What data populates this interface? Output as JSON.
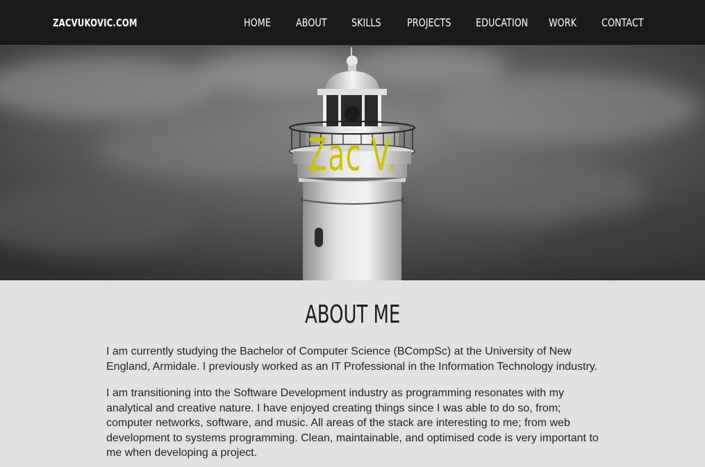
{
  "nav": {
    "brand": "ZACVUKOVIC.COM",
    "links": [
      "HOME",
      "ABOUT",
      "SKILLS",
      "PROJECTS",
      "EDUCATION",
      "WORK",
      "CONTACT"
    ]
  },
  "hero": {
    "title": "Zac V."
  },
  "about": {
    "heading": "ABOUT ME",
    "paragraphs": [
      "I am currently studying the Bachelor of Computer Science (BCompSc) at the University of New England, Armidale. I previously worked as an IT Professional in the Information Technology industry.",
      "I am transitioning into the Software Development industry as programming resonates with my analytical and creative nature. I have enjoyed creating things since I was able to do so, from; computer networks, software, and music. All areas of the stack are interesting to me; from web development to systems programming. Clean, maintainable, and optimised code is very important to me when developing a project."
    ]
  },
  "colors": {
    "navbar_bg": "#1a1a1a",
    "hero_title": "#c9c400",
    "section_bg": "#e2e2e2",
    "text": "#222222"
  }
}
